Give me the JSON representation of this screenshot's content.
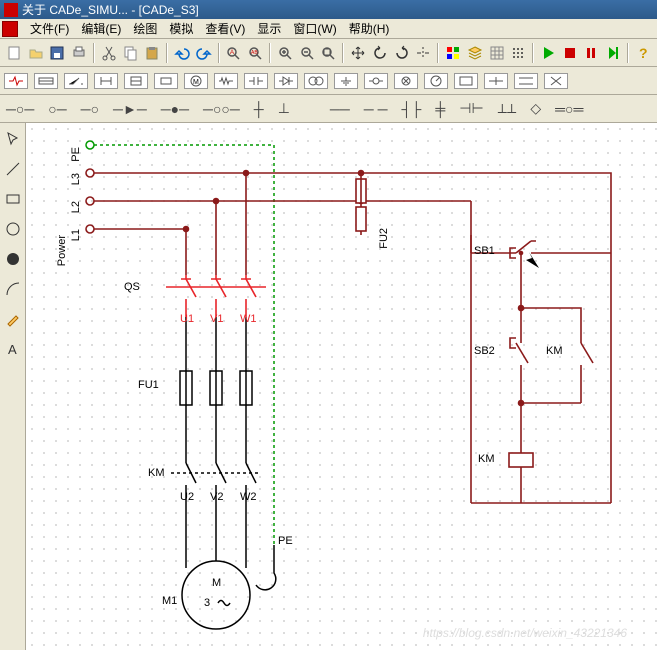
{
  "title": "关于 CADe_SIMU... - [CADe_S3]",
  "menu": {
    "file": "文件(F)",
    "edit": "编辑(E)",
    "draw": "绘图",
    "sim": "模拟",
    "view": "查看(V)",
    "display": "显示",
    "window": "窗口(W)",
    "help": "帮助(H)"
  },
  "labels": {
    "power": "Power",
    "PE": "PE",
    "L3": "L3",
    "L2": "L2",
    "L1": "L1",
    "QS": "QS",
    "U1": "U1",
    "V1": "V1",
    "W1": "W1",
    "FU1": "FU1",
    "FU2": "FU2",
    "KM": "KM",
    "U2": "U2",
    "V2": "V2",
    "W2": "W2",
    "PE2": "PE",
    "M1": "M1",
    "M": "M",
    "three": "3",
    "SB1": "SB1",
    "SB2": "SB2"
  },
  "watermark": "https://blog.csdn.net/weixin_43221346"
}
